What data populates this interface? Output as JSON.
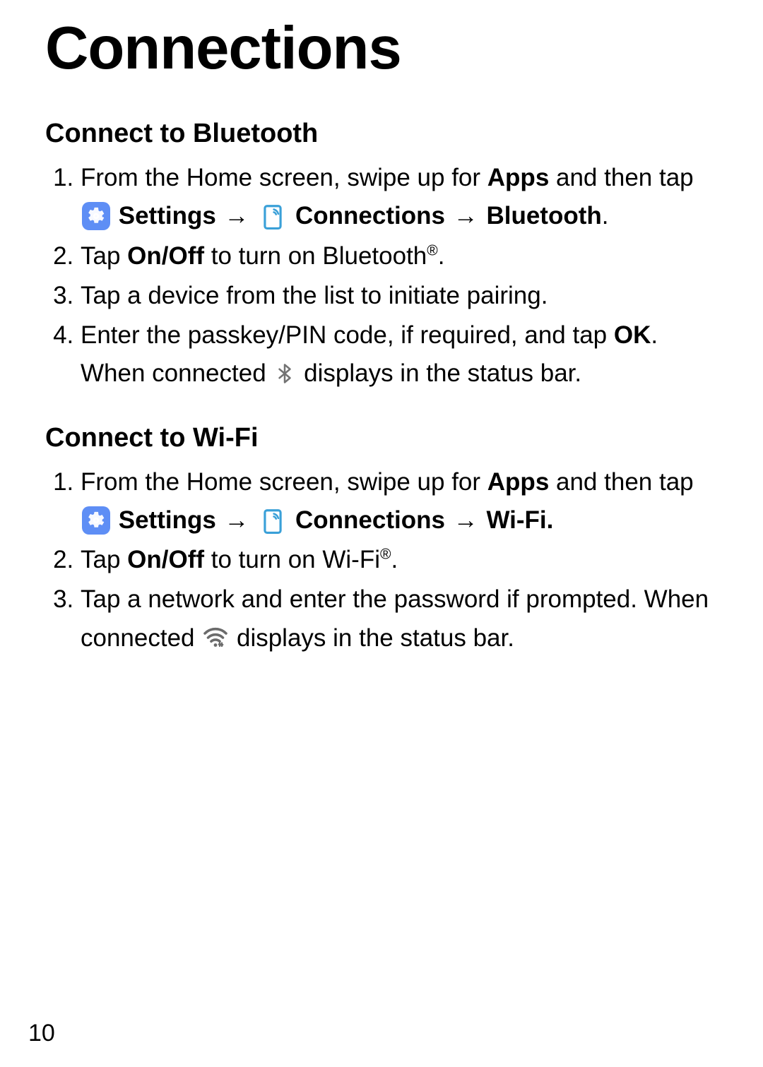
{
  "title": "Connections",
  "page_number": "10",
  "arrow": "→",
  "labels": {
    "apps": "Apps",
    "settings": "Settings",
    "connections": "Connections",
    "bluetooth": "Bluetooth",
    "wifi": "Wi-Fi.",
    "onoff": "On/Off",
    "ok": "OK"
  },
  "bluetooth": {
    "heading": "Connect to Bluetooth",
    "step1_a": "From the Home screen, swipe up for ",
    "step1_b": " and then tap ",
    "step2_a": "Tap ",
    "step2_b": " to turn on Bluetooth",
    "step2_c": ".",
    "step3": "Tap a device from the list to initiate pairing.",
    "step4_a": "Enter the passkey/PIN code, if required, and tap ",
    "step4_b": ". When connected ",
    "step4_c": " displays in the status bar."
  },
  "wifi": {
    "heading": "Connect to Wi-Fi",
    "step1_a": "From the Home screen, swipe up for ",
    "step1_b": " and then tap ",
    "step2_a": "Tap ",
    "step2_b": " to turn on Wi-Fi",
    "step2_c": ".",
    "step3_a": "Tap a network and enter the password if prompted. When connected ",
    "step3_b": " displays in the status bar."
  },
  "reg": "®",
  "period": "."
}
